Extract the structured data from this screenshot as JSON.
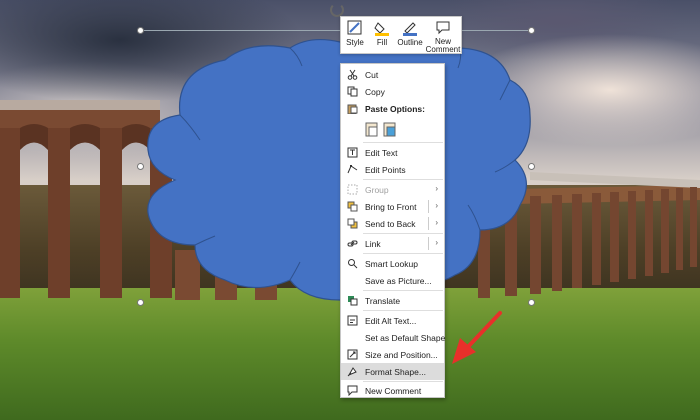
{
  "mini_toolbar": {
    "style_label": "Style",
    "fill_label": "Fill",
    "outline_label": "Outline",
    "new_comment_label_1": "New",
    "new_comment_label_2": "Comment"
  },
  "context_menu": {
    "items": [
      {
        "label": "Cut",
        "icon": "scissors-icon"
      },
      {
        "label": "Copy",
        "icon": "copy-icon"
      },
      {
        "label": "Paste Options:",
        "icon": "paste-icon"
      },
      {
        "label": "Edit Text",
        "icon": "edit-text-icon"
      },
      {
        "label": "Edit Points",
        "icon": "edit-points-icon"
      },
      {
        "label": "Group",
        "icon": "group-icon"
      },
      {
        "label": "Bring to Front",
        "icon": "bring-to-front-icon"
      },
      {
        "label": "Send to Back",
        "icon": "send-to-back-icon"
      },
      {
        "label": "Link",
        "icon": "link-icon"
      },
      {
        "label": "Smart Lookup",
        "icon": "search-icon"
      },
      {
        "label": "Save as Picture...",
        "icon": ""
      },
      {
        "label": "Translate",
        "icon": "translate-icon"
      },
      {
        "label": "Edit Alt Text...",
        "icon": "alt-text-icon"
      },
      {
        "label": "Set as Default Shape",
        "icon": ""
      },
      {
        "label": "Size and Position...",
        "icon": "size-position-icon"
      },
      {
        "label": "Format Shape...",
        "icon": "format-shape-icon"
      },
      {
        "label": "New Comment",
        "icon": "comment-icon"
      }
    ]
  },
  "colors": {
    "shape_fill": "#4472C4",
    "shape_outline": "#2F528F",
    "arrow": "#E8302A",
    "fill_accent": "#FFC000",
    "outline_accent": "#4472C4"
  }
}
